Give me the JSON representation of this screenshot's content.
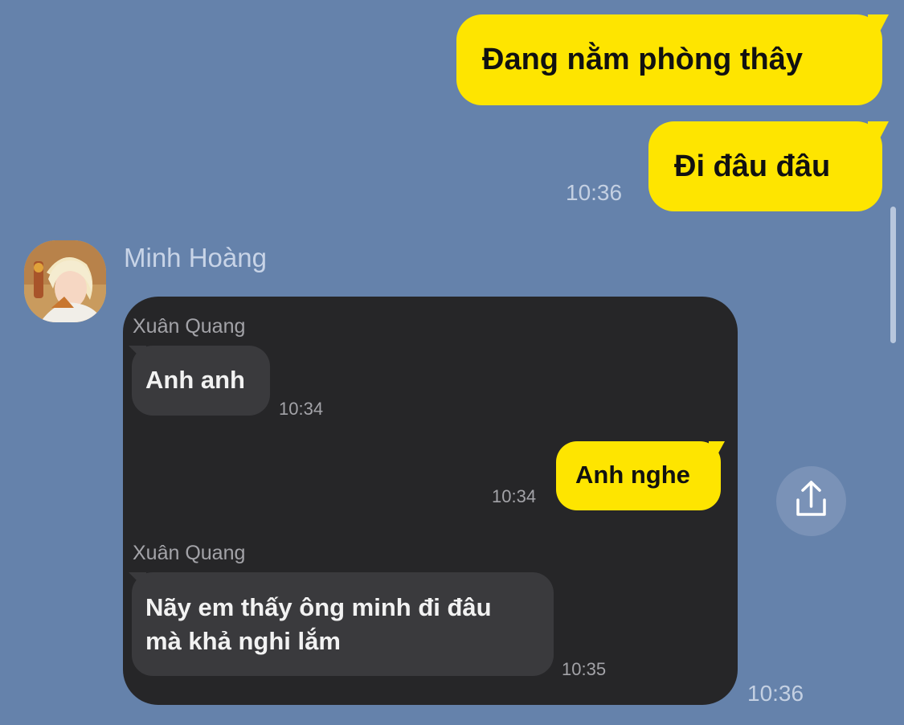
{
  "colors": {
    "background": "#6582ab",
    "outgoing_bubble": "#fee500",
    "card_background": "#262628",
    "incoming_bubble": "#3a3a3d"
  },
  "messages_out": [
    {
      "text": "Đang nằm phòng thây"
    },
    {
      "text": "Đi đâu đâu",
      "time": "10:36"
    }
  ],
  "incoming": {
    "sender": "Minh Hoàng",
    "time": "10:36",
    "avatar_icon": "avatar-photo-icon",
    "shared_screenshot": {
      "messages": [
        {
          "sender": "Xuân Quang",
          "text": "Anh anh",
          "time": "10:34"
        },
        {
          "text": "Anh nghe",
          "time": "10:34"
        },
        {
          "sender": "Xuân Quang",
          "lines": [
            "Nãy em thấy ông minh đi đâu",
            "mà khả nghi lắm"
          ],
          "time": "10:35"
        }
      ]
    }
  },
  "share_button": {
    "icon": "share-icon"
  }
}
